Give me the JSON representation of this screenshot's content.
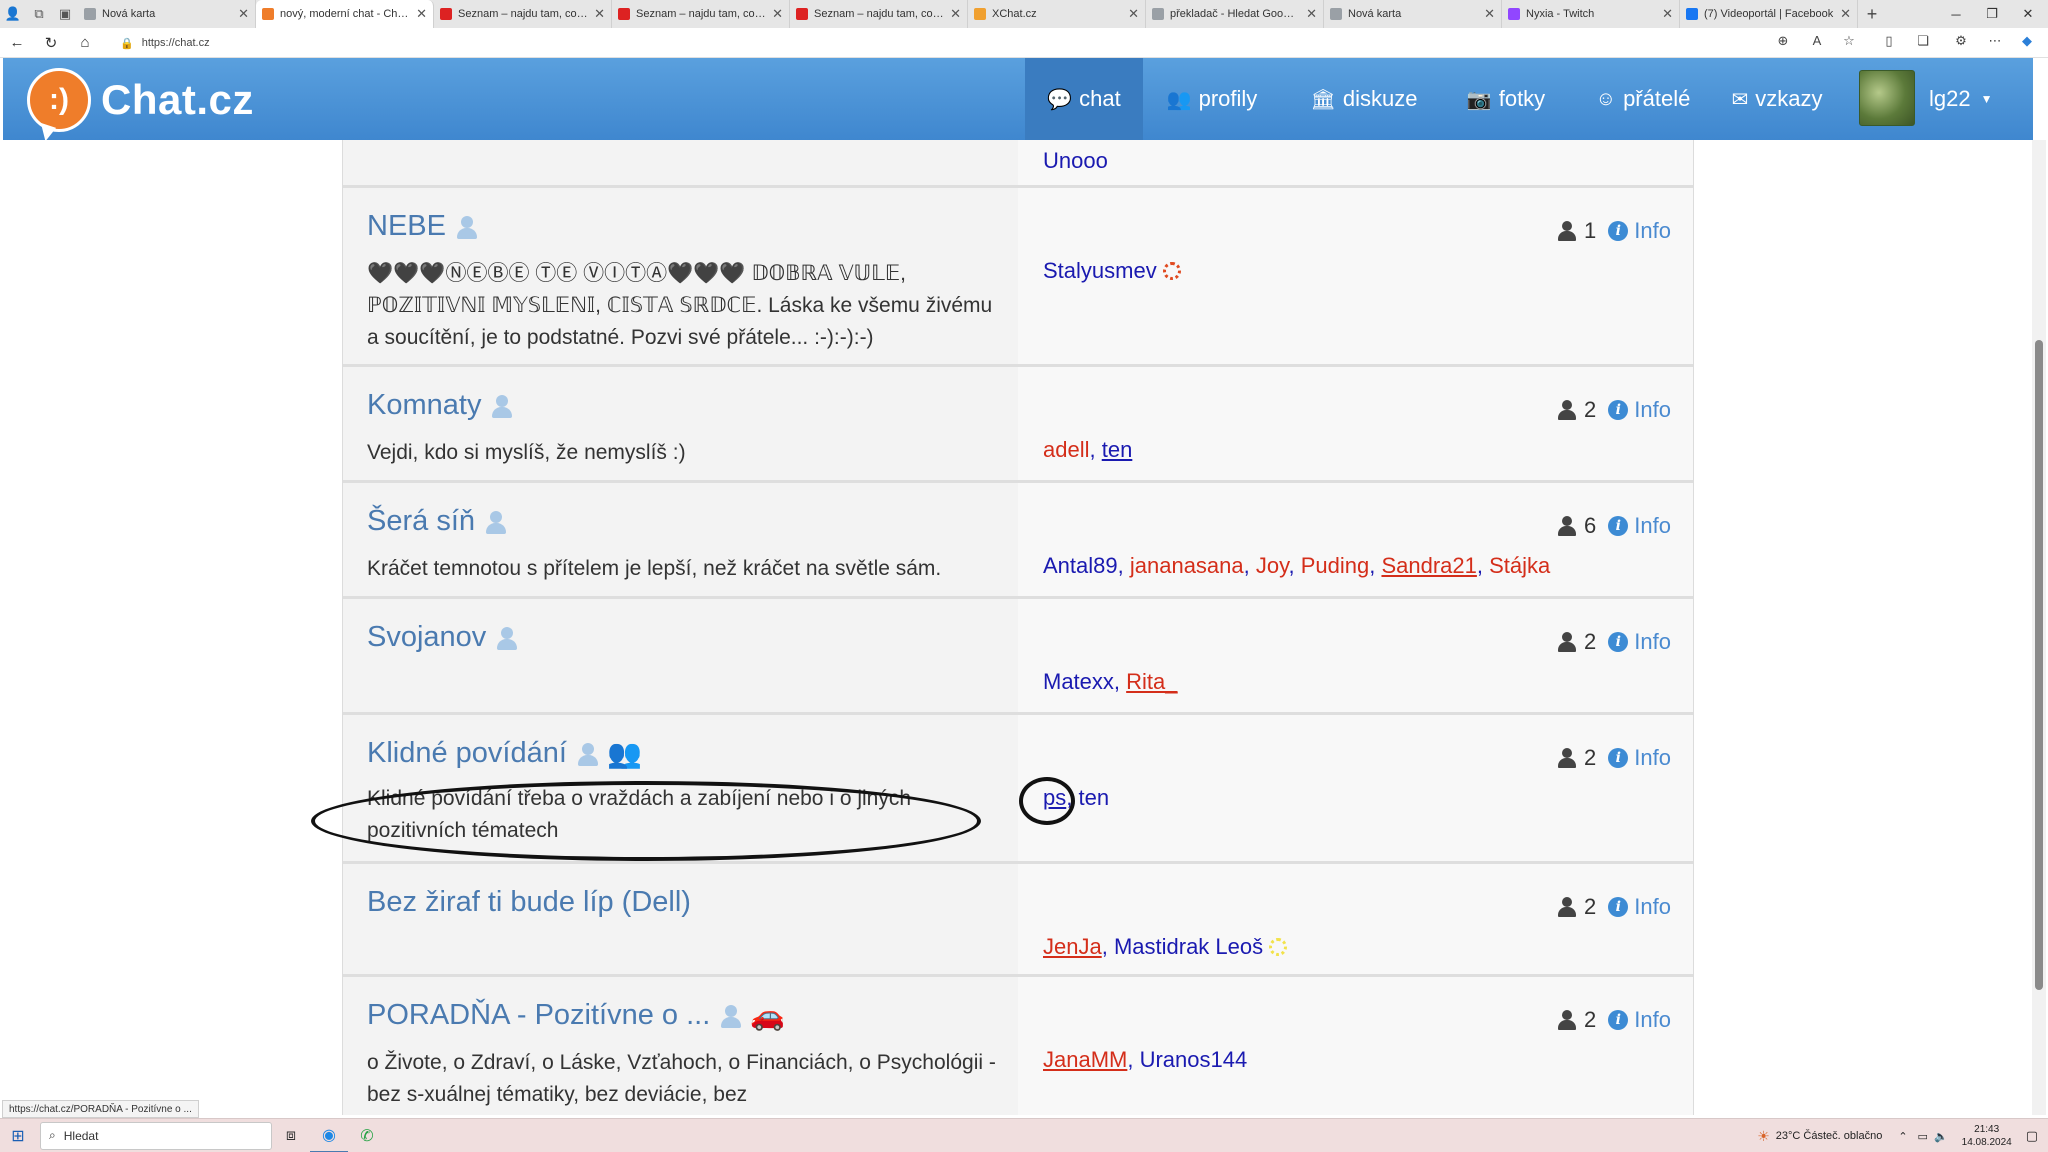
{
  "browser": {
    "tabs": [
      {
        "title": "Nová karta",
        "active": false,
        "fav_color": "#9aa0a6"
      },
      {
        "title": "nový, moderní chat - Chat.cz",
        "active": true,
        "fav_color": "#ef7d2a"
      },
      {
        "title": "Seznam – najdu tam, co nezn",
        "active": false,
        "fav_color": "#d22"
      },
      {
        "title": "Seznam – najdu tam, co nezn",
        "active": false,
        "fav_color": "#d22"
      },
      {
        "title": "Seznam – najdu tam, co nezn",
        "active": false,
        "fav_color": "#d22"
      },
      {
        "title": "XChat.cz",
        "active": false,
        "fav_color": "#f0a030"
      },
      {
        "title": "překladač - Hledat Googlem",
        "active": false,
        "fav_color": "#9aa0a6"
      },
      {
        "title": "Nová karta",
        "active": false,
        "fav_color": "#9aa0a6"
      },
      {
        "title": "Nyxia - Twitch",
        "active": false,
        "fav_color": "#9146ff"
      },
      {
        "title": "(7) Videoportál | Facebook",
        "active": false,
        "fav_color": "#1877f2"
      }
    ],
    "url": "https://chat.cz",
    "status_url": "https://chat.cz/PORADŇA - Pozitívne o ..."
  },
  "site": {
    "logo_text": "Chat.cz",
    "nav": [
      {
        "label": "chat",
        "icon": "chat-bubble-icon",
        "glyph": "💬",
        "active": true
      },
      {
        "label": "profily",
        "icon": "users-icon",
        "glyph": "👥",
        "active": false
      },
      {
        "label": "diskuze",
        "icon": "bank-icon",
        "glyph": "🏛",
        "active": false
      },
      {
        "label": "fotky",
        "icon": "camera-icon",
        "glyph": "📷",
        "active": false
      },
      {
        "label": "přátelé",
        "icon": "smiley-icon",
        "glyph": "☺",
        "active": false
      },
      {
        "label": "vzkazy",
        "icon": "envelope-icon",
        "glyph": "✉",
        "active": false
      }
    ],
    "username": "lg22"
  },
  "top_partial": {
    "users": [
      {
        "name": "Unooo",
        "color": "blue"
      }
    ]
  },
  "rooms": [
    {
      "name": "NEBE",
      "desc": "🖤🖤🖤ⓃⒺⒷⒺ ⓉⒺ ⓋⒾⓉⒶ🖤🖤🖤 𝔻𝕆𝔹ℝ𝔸 𝕍𝕌𝕃𝔼, ℙ𝕆ℤ𝕀𝕋𝕀𝕍ℕ𝕀 𝕄𝕐𝕊𝕃𝔼ℕ𝕀, ℂ𝕀𝕊𝕋𝔸 𝕊ℝ𝔻ℂ𝔼. Láska ke všemu živému a soucítění, je to podstatné. Pozvi své přátele... :-):-):-)",
      "count": "1",
      "info": "Info",
      "users": [
        {
          "name": "Stalyusmev",
          "color": "blue",
          "sun": "#e04a20"
        }
      ]
    },
    {
      "name": "Komnaty",
      "desc": "Vejdi, kdo si myslíš, že nemyslíš :)",
      "count": "2",
      "info": "Info",
      "users": [
        {
          "name": "adell",
          "color": "red"
        },
        {
          "name": "ten",
          "color": "blue",
          "underline": true
        }
      ]
    },
    {
      "name": "Šerá síň",
      "desc": "Kráčet temnotou s přítelem je lepší, než kráčet na světle sám.",
      "count": "6",
      "info": "Info",
      "users": [
        {
          "name": "Antal89",
          "color": "blue"
        },
        {
          "name": "jananasana",
          "color": "red"
        },
        {
          "name": "Joy",
          "color": "red"
        },
        {
          "name": "Puding",
          "color": "red"
        },
        {
          "name": "Sandra21",
          "color": "red",
          "underline": true
        },
        {
          "name": "Stájka",
          "color": "red"
        }
      ]
    },
    {
      "name": "Svojanov",
      "desc": "",
      "count": "2",
      "info": "Info",
      "users": [
        {
          "name": "Matexx",
          "color": "blue"
        },
        {
          "name": "Rita_",
          "color": "red",
          "underline": true
        }
      ]
    },
    {
      "name": "Klidné povídání",
      "desc": "Klidné povídání třeba o vraždách a zabíjení nebo i o jiných pozitivních tématech",
      "count": "2",
      "info": "Info",
      "extra_icon": "group-icon",
      "users": [
        {
          "name": "ps",
          "color": "blue",
          "underline": true
        },
        {
          "name": "ten",
          "color": "blue"
        }
      ]
    },
    {
      "name": "Bez žiraf ti bude líp (Dell)",
      "desc": "",
      "count": "2",
      "info": "Info",
      "no_person": true,
      "users": [
        {
          "name": "JenJa",
          "color": "red",
          "underline": true
        },
        {
          "name": "Mastidrak Leoš",
          "color": "blue",
          "sun": "#f2e24a"
        }
      ]
    },
    {
      "name": "PORADŇA - Pozitívne o ...",
      "desc": "o Živote, o Zdraví, o Láske, Vzťahoch, o Financiách, o Psychológii - bez s-xuálnej tématiky, bez deviácie, bez",
      "count": "2",
      "info": "Info",
      "extra_icon": "car-icon",
      "users": [
        {
          "name": "JanaMM",
          "color": "red",
          "underline": true
        },
        {
          "name": "Uranos144",
          "color": "blue"
        }
      ]
    }
  ],
  "taskbar": {
    "search_placeholder": "Hledat",
    "weather": "23°C  Částeč. oblačno",
    "time": "21:43",
    "date": "14.08.2024"
  },
  "colors": {
    "header": "#4a93d8",
    "user_blue": "#1a1ab0",
    "user_red": "#d42e1a",
    "info_blue": "#4a8ad0"
  }
}
